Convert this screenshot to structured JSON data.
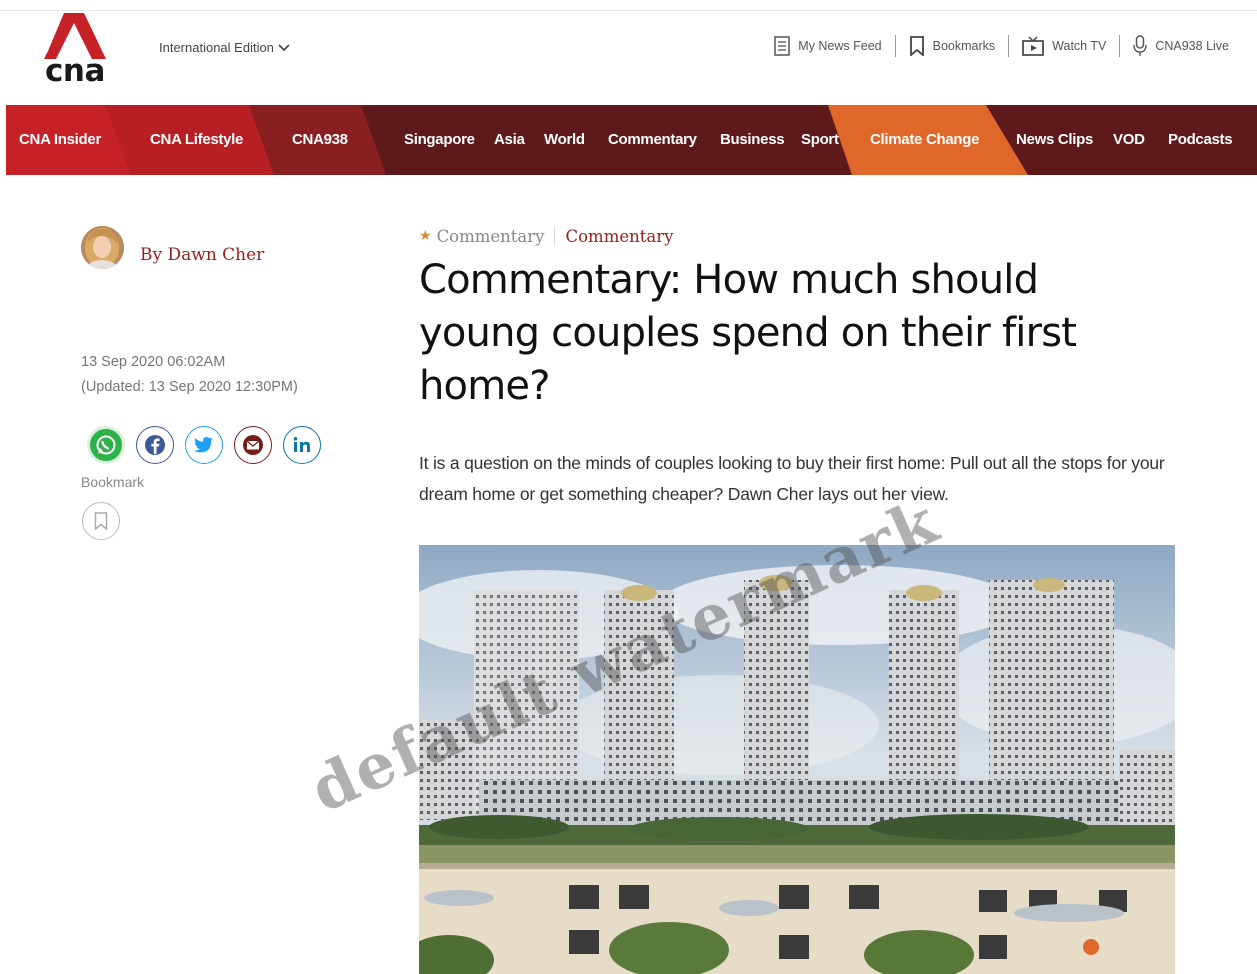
{
  "header": {
    "logo_text": "cna",
    "edition_label": "International Edition",
    "util_nav": [
      {
        "label": "My News Feed",
        "icon": "newsfeed-icon"
      },
      {
        "label": "Bookmarks",
        "icon": "bookmark-icon"
      },
      {
        "label": "Watch TV",
        "icon": "tv-icon"
      },
      {
        "label": "CNA938 Live",
        "icon": "microphone-icon"
      }
    ]
  },
  "nav": {
    "items": [
      {
        "label": "CNA Insider"
      },
      {
        "label": "CNA Lifestyle"
      },
      {
        "label": "CNA938"
      },
      {
        "label": "Singapore"
      },
      {
        "label": "Asia"
      },
      {
        "label": "World"
      },
      {
        "label": "Commentary"
      },
      {
        "label": "Business"
      },
      {
        "label": "Sport"
      },
      {
        "label": "Climate Change"
      },
      {
        "label": "News Clips"
      },
      {
        "label": "VOD"
      },
      {
        "label": "Podcasts"
      }
    ],
    "colors": {
      "brand_red": "#c62127",
      "dark_red": "#5e1a1a",
      "mid_red": "#8a1f21",
      "orange": "#e0672a"
    }
  },
  "article": {
    "author": "By Dawn Cher",
    "published": "13 Sep 2020 06:02AM",
    "updated": "(Updated: 13 Sep 2020 12:30PM)",
    "share_icons": [
      "whatsapp-icon",
      "facebook-icon",
      "twitter-icon",
      "email-icon",
      "linkedin-icon"
    ],
    "bookmark_label": "Bookmark",
    "kicker_primary": "Commentary",
    "kicker_secondary": "Commentary",
    "headline": "Commentary: How much should young couples spend on their first home?",
    "summary": "It is a question on the minds of couples looking to buy their first home: Pull out all the stops for your dream home or get something cheaper? Dawn Cher lays out her view.",
    "watermark": "default watermark"
  }
}
